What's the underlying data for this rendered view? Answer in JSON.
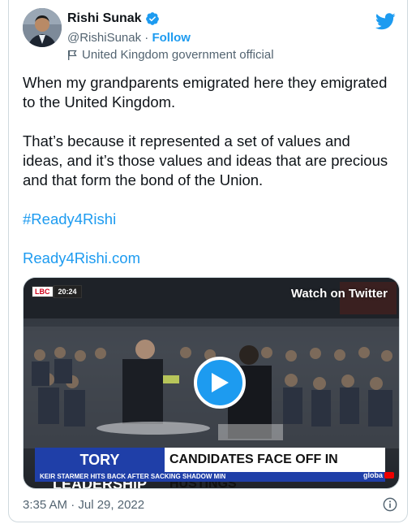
{
  "author": {
    "name": "Rishi Sunak",
    "handle": "@RishiSunak",
    "separator": "·",
    "follow_label": "Follow",
    "label": "United Kingdom government official"
  },
  "tweet": {
    "paragraph1": "When my grandparents emigrated here they emigrated to the United Kingdom.",
    "paragraph2": "That’s because it represented a set of values and ideas, and it’s those values and ideas that are precious and that form the bond of the Union.",
    "hashtag": "#Ready4Rishi",
    "link": "Ready4Rishi.com"
  },
  "media": {
    "watch_label": "Watch on Twitter",
    "channel_logo": "LBC",
    "clock": "20:24",
    "banner_left": "TORY LEADERSHIP",
    "banner_right": "CANDIDATES FACE OFF IN HUSTINGS",
    "ticker": "KEIR STARMER HITS BACK AFTER SACKING SHADOW MIN",
    "corner_brand": "globa"
  },
  "footer": {
    "timestamp": "3:35 AM · Jul 29, 2022"
  },
  "icons": {
    "verified": "verified-badge-icon",
    "government": "flag-icon",
    "logo": "twitter-bird-icon",
    "play": "play-icon",
    "info": "info-icon"
  },
  "colors": {
    "accent": "#1d9bf0",
    "secondary_text": "#536471",
    "banner_blue": "#1f3fa8"
  }
}
